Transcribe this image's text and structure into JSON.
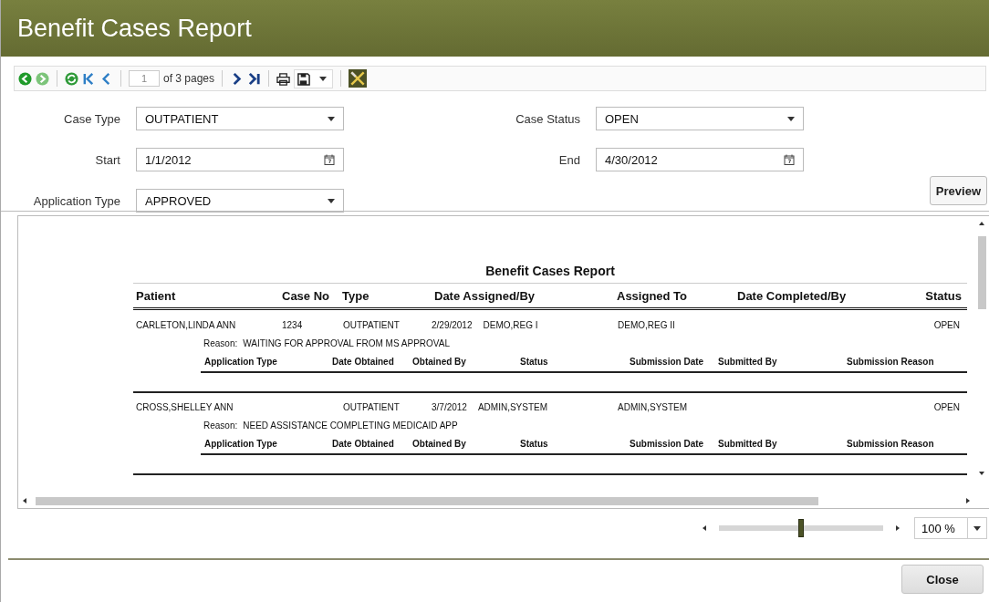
{
  "window": {
    "title": "Benefit Cases Report"
  },
  "toolbar": {
    "page": "1",
    "page_count": "of 3 pages"
  },
  "filters": [
    {
      "label": "Case Type",
      "kind": "dropdown",
      "value": "OUTPATIENT"
    },
    {
      "label": "Case Status",
      "kind": "dropdown",
      "value": "OPEN"
    },
    {
      "label": "Start",
      "kind": "date",
      "value": "1/1/2012"
    },
    {
      "label": "End",
      "kind": "date",
      "value": "4/30/2012"
    },
    {
      "label": "Application Type",
      "kind": "dropdown",
      "value": "APPROVED"
    }
  ],
  "preview_button": "Preview",
  "report": {
    "title": "Benefit Cases Report",
    "columns": [
      "Patient",
      "Case No",
      "Type",
      "Date Assigned/By",
      "Assigned To",
      "Date Completed/By",
      "Status"
    ],
    "rows": [
      {
        "patient": "CARLETON,LINDA ANN",
        "case_no": "1234",
        "type": "OUTPATIENT",
        "date_assigned": "2/29/2012",
        "assigned_by": "DEMO,REG I",
        "assigned_to": "DEMO,REG II",
        "status": "OPEN",
        "reason_label": "Reason:",
        "reason": "WAITING FOR APPROVAL FROM MS APPROVAL",
        "sub_columns": [
          "Application Type",
          "Date Obtained",
          "Obtained By",
          "Status",
          "Submission Date",
          "Submitted By",
          "Submission Reason"
        ]
      },
      {
        "patient": "CROSS,SHELLEY ANN",
        "type": "OUTPATIENT",
        "date_assigned": "3/7/2012",
        "assigned_by": "ADMIN,SYSTEM",
        "assigned_to": "ADMIN,SYSTEM",
        "status": "OPEN",
        "reason_label": "Reason:",
        "reason": "NEED ASSISTANCE COMPLETING MEDICAID APP",
        "sub_columns": [
          "Application Type",
          "Date Obtained",
          "Obtained By",
          "Status",
          "Submission Date",
          "Submitted By",
          "Submission Reason"
        ]
      }
    ]
  },
  "zoom": {
    "level": 0.5,
    "value": "100 %"
  },
  "close_button": "Close"
}
